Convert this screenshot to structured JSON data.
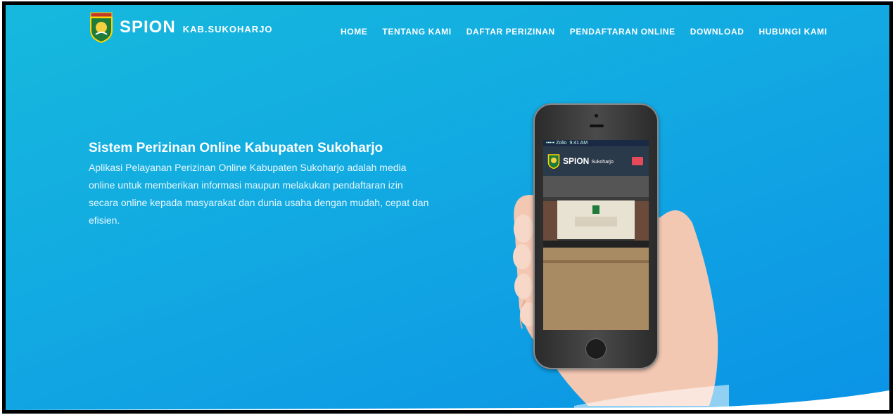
{
  "header": {
    "brand": "SPION",
    "brand_sub": "KAB.SUKOHARJO",
    "logo_icon": "regency-emblem-icon"
  },
  "nav": {
    "items": [
      {
        "label": "HOME"
      },
      {
        "label": "TENTANG KAMI"
      },
      {
        "label": "DAFTAR PERIZINAN"
      },
      {
        "label": "PENDAFTARAN ONLINE"
      },
      {
        "label": "DOWNLOAD"
      },
      {
        "label": "HUBUNGI KAMI"
      }
    ]
  },
  "hero": {
    "title": "Sistem Perizinan Online Kabupaten Sukoharjo",
    "description": "Aplikasi Pelayanan Perizinan Online Kabupaten Sukoharjo adalah media online untuk memberikan informasi maupun melakukan pendaftaran izin secara online kepada masyarakat dan dunia usaha dengan mudah, cepat dan efisien."
  },
  "phone_screen": {
    "status_carrier": "••••• Zolio",
    "status_time": "9:41 AM",
    "app_title": "SPION",
    "app_sub": "Sukoharjo",
    "menu_icon": "hamburger-menu-icon"
  },
  "colors": {
    "background_start": "#16b9dd",
    "background_end": "#0b93e6",
    "text": "#ffffff",
    "menu_button": "#e64a5a"
  }
}
